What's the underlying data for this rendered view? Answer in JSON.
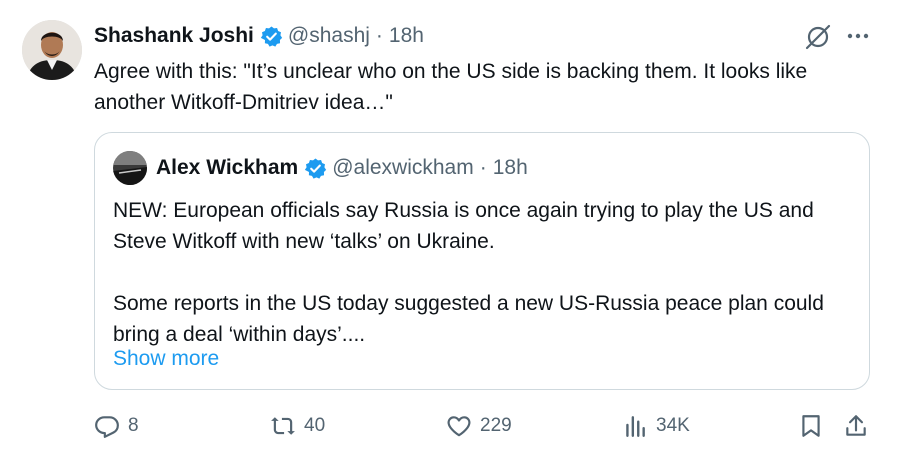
{
  "tweet": {
    "author_name": "Shashank Joshi",
    "handle": "@shashj",
    "separator": "·",
    "time": "18h",
    "text": "Agree with this: \"It’s unclear who on the US side is backing them. It looks like another Witkoff-Dmitriev idea…\""
  },
  "quoted": {
    "author_name": "Alex Wickham",
    "handle": "@alexwickham",
    "separator": "·",
    "time": "18h",
    "paragraph_1": "NEW: European officials say Russia is once again trying to play the US and Steve Witkoff with new ‘talks’ on Ukraine.",
    "paragraph_2": "Some reports in the US today suggested a new US-Russia peace plan could bring a deal ‘within days’....",
    "show_more": "Show more"
  },
  "actions": {
    "replies": "8",
    "retweets": "40",
    "likes": "229",
    "views": "34K"
  },
  "colors": {
    "verified": "#1d9bf0",
    "link": "#1d9bf0",
    "secondary_text": "#536471",
    "border": "#cfd9de"
  }
}
